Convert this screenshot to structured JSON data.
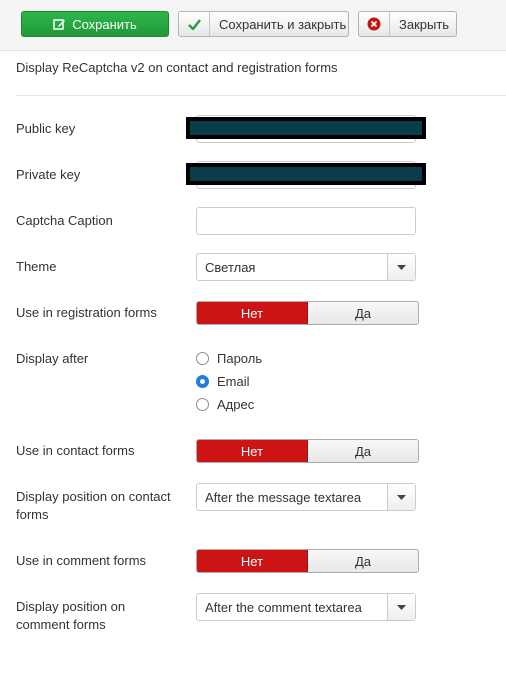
{
  "toolbar": {
    "save_label": "Сохранить",
    "save_close_label": "Сохранить и закрыть",
    "close_label": "Закрыть"
  },
  "description": "Display ReCaptcha v2 on contact and registration forms",
  "fields": {
    "public_key": {
      "label": "Public key"
    },
    "private_key": {
      "label": "Private key"
    },
    "captcha_caption": {
      "label": "Captcha Caption",
      "value": ""
    },
    "theme": {
      "label": "Theme",
      "value": "Светлая"
    },
    "use_registration": {
      "label": "Use in registration forms",
      "no": "Нет",
      "yes": "Да",
      "selected": "no"
    },
    "display_after": {
      "label": "Display after",
      "options": [
        "Пароль",
        "Email",
        "Адрес"
      ],
      "selected": "Email"
    },
    "use_contact": {
      "label": "Use in contact forms",
      "no": "Нет",
      "yes": "Да",
      "selected": "no"
    },
    "contact_position": {
      "label_line1": "Display position on contact",
      "label_line2": "forms",
      "value": "After the message textarea"
    },
    "use_comment": {
      "label": "Use in comment forms",
      "no": "Нет",
      "yes": "Да",
      "selected": "no"
    },
    "comment_position": {
      "label_line1": "Display position on",
      "label_line2": "comment forms",
      "value": "After the comment textarea"
    }
  },
  "colors": {
    "save_green": "#2fb54a",
    "toggle_red": "#cd1414",
    "radio_blue": "#1e7ed8"
  }
}
